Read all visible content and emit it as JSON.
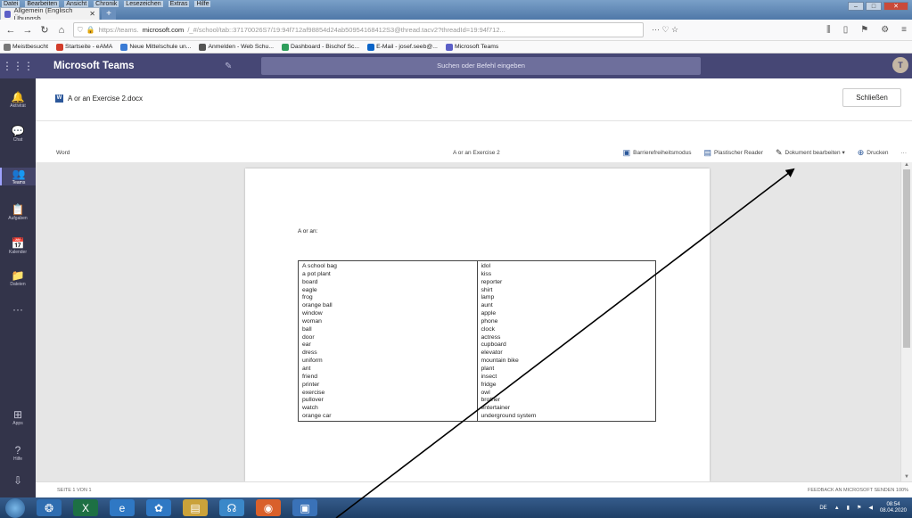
{
  "browser": {
    "menu": [
      "Datei",
      "Bearbeiten",
      "Ansicht",
      "Chronik",
      "Lesezeichen",
      "Extras",
      "Hilfe"
    ],
    "tab_title": "Allgemein (Englisch Übungsb",
    "url_prefix": "https://teams.",
    "url_host": "microsoft.com",
    "url_rest": "/_#/school/tab::37170026S7/19:94f712af98854d24ab50954168412S3@thread.tacv2?threadId=19:94f712...",
    "url_actions": "··· ♡ ☆",
    "bookmarks": [
      {
        "label": "Meistbesucht",
        "color": "#777777"
      },
      {
        "label": "Startseite - eAMA",
        "color": "#d23c2a"
      },
      {
        "label": "Neue Mittelschule un...",
        "color": "#3a7bd5"
      },
      {
        "label": "Anmelden - Web Schu...",
        "color": "#555555"
      },
      {
        "label": "Dashboard - Bischof Sc...",
        "color": "#2e9e5b"
      },
      {
        "label": "E-Mail - josef.seeb@...",
        "color": "#0a64c8"
      },
      {
        "label": "Microsoft Teams",
        "color": "#5b5fc7"
      }
    ]
  },
  "teams": {
    "app_name": "Microsoft Teams",
    "search_placeholder": "Suchen oder Befehl eingeben",
    "avatar_initial": "T",
    "rail": [
      {
        "icon": "🔔",
        "label": "Aktivität",
        "name": "activity"
      },
      {
        "icon": "💬",
        "label": "Chat",
        "name": "chat"
      },
      {
        "icon": "👥",
        "label": "Teams",
        "name": "teams"
      },
      {
        "icon": "📋",
        "label": "Aufgaben",
        "name": "assignments"
      },
      {
        "icon": "📅",
        "label": "Kalender",
        "name": "calendar"
      },
      {
        "icon": "📁",
        "label": "Dateien",
        "name": "files"
      },
      {
        "icon": "···",
        "label": "",
        "name": "more"
      },
      {
        "icon": "⊞",
        "label": "Apps",
        "name": "apps"
      },
      {
        "icon": "?",
        "label": "Hilfe",
        "name": "help"
      },
      {
        "icon": "⇩",
        "label": "",
        "name": "download"
      }
    ]
  },
  "document": {
    "filename": "A or an Exercise 2.docx",
    "close_label": "Schließen",
    "app_label": "Word",
    "doc_name": "A or an Exercise 2",
    "toolbar": {
      "accessibility": "Barrierefreiheitsmodus",
      "reader": "Plastischer Reader",
      "edit": "Dokument bearbeiten ▾",
      "print": "Drucken",
      "more": "···"
    },
    "heading": "A or an:",
    "left_words": [
      "A school bag",
      "a pot plant",
      "board",
      "eagle",
      "frog",
      "orange ball",
      "window",
      "woman",
      "ball",
      "door",
      "ear",
      "dress",
      "uniform",
      "ant",
      "friend",
      "printer",
      "exercise",
      "pullover",
      "watch",
      "orange car"
    ],
    "right_words": [
      "idol",
      "kiss",
      "reporter",
      "shirt",
      "lamp",
      "aunt",
      "apple",
      "phone",
      "clock",
      "actress",
      "cupboard",
      "elevator",
      "mountain bike",
      "plant",
      "insect",
      "fridge",
      "owl",
      "brother",
      "entertainer",
      "underground system"
    ],
    "status_left": "SEITE 1 VON 1",
    "status_right": "FEEDBACK AN MICROSOFT SENDEN   100%"
  },
  "taskbar": {
    "items": [
      {
        "name": "explorer",
        "glyph": "❂",
        "color": "#2f6db0"
      },
      {
        "name": "excel",
        "glyph": "X",
        "color": "#1d7044"
      },
      {
        "name": "internet-explorer",
        "glyph": "e",
        "color": "#2f78c4"
      },
      {
        "name": "settings",
        "glyph": "✿",
        "color": "#2f78c4"
      },
      {
        "name": "file-manager",
        "glyph": "▤",
        "color": "#caa23a"
      },
      {
        "name": "people",
        "glyph": "☊",
        "color": "#3b88c9"
      },
      {
        "name": "firefox",
        "glyph": "◉",
        "color": "#d9602b"
      },
      {
        "name": "app",
        "glyph": "▣",
        "color": "#3a72b8"
      }
    ],
    "lang": "DE",
    "time": "08:54",
    "date": "08.04.2020"
  },
  "colors": {
    "teams_header": "#464775",
    "rail": "#33344a",
    "word_blue": "#2b579a"
  }
}
